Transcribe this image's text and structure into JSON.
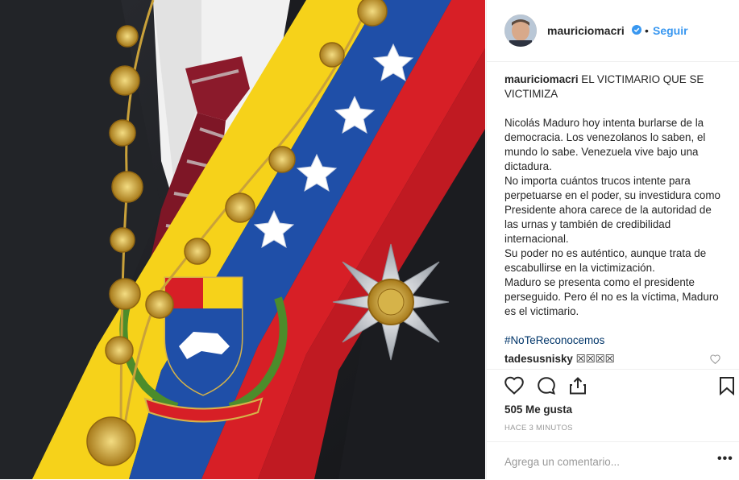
{
  "post": {
    "username": "mauriciomacri",
    "follow_label": "Seguir",
    "dot": "•"
  },
  "caption": {
    "username": "mauriciomacri",
    "title": "EL VICTIMARIO QUE SE VICTIMIZA",
    "paragraph_1": "Nicolás Maduro hoy intenta burlarse de la democracia. Los venezolanos lo saben, el mundo lo sabe. Venezuela vive bajo una dictadura.",
    "paragraph_2": "No importa cuántos trucos intente para perpetuarse en el poder, su investidura como Presidente ahora carece de la autoridad de las urnas y también de credibilidad internacional.",
    "paragraph_3": "Su poder no es auténtico, aunque trata de escabullirse en la victimización.",
    "paragraph_4": "Maduro se presenta como el presidente perseguido. Pero él no es la víctima, Maduro es el victimario.",
    "hashtag": "#NoTeReconocemos"
  },
  "comment": {
    "username": "tadesusnisky",
    "text": "☒☒☒☒"
  },
  "stats": {
    "likes": "505 Me gusta",
    "timestamp": "HACE 3 MINUTOS"
  },
  "add_comment": {
    "placeholder": "Agrega un comentario...",
    "more": "•••"
  },
  "icons": [
    "heart-icon",
    "comment-icon",
    "share-icon",
    "bookmark-icon",
    "verified-badge-icon",
    "small-heart-icon"
  ],
  "colors": {
    "link": "#3897f0",
    "hashtag": "#003569",
    "flag_yellow": "#f6d21a",
    "flag_blue": "#1f4fa8",
    "flag_red": "#d71f26"
  }
}
